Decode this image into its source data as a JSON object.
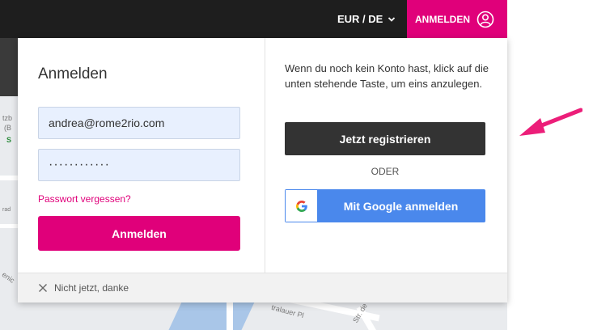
{
  "header": {
    "currency_label": "EUR / DE",
    "login_tab_label": "ANMELDEN"
  },
  "login_panel": {
    "title": "Anmelden",
    "email_value": "andrea@rome2rio.com",
    "password_value": "············",
    "forgot_password": "Passwort vergessen?",
    "submit_label": "Anmelden"
  },
  "register_panel": {
    "info_text": "Wenn du noch kein Konto hast, klick auf die unten stehende Taste, um eins anzulegen.",
    "register_label": "Jetzt registrieren",
    "or_label": "ODER",
    "google_label": "Mit Google anmelden"
  },
  "footer": {
    "dismiss_label": "Nicht jetzt, danke"
  },
  "map": {
    "labels": [
      "tzb",
      "(B",
      "S",
      "rad",
      "enic",
      "tralauer Pl",
      "Str. de"
    ]
  },
  "colors": {
    "brand_pink": "#e0007a",
    "topbar_dark": "#1e1e1e",
    "register_dark": "#333333",
    "google_blue": "#4a88ec",
    "field_bg": "#e8f0fe"
  },
  "icons": {
    "user": "user-circle-icon",
    "chevron": "chevron-down-icon",
    "close": "close-icon",
    "google": "google-g-icon",
    "arrow": "pink-arrow-icon"
  }
}
